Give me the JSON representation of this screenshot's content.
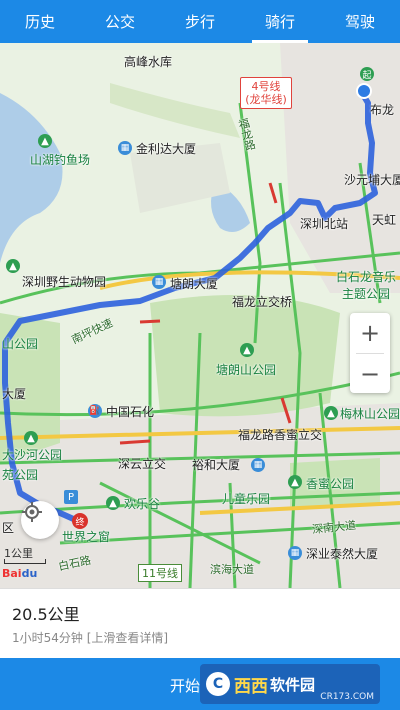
{
  "tabs": [
    {
      "label": "历史"
    },
    {
      "label": "公交"
    },
    {
      "label": "步行"
    },
    {
      "label": "骑行"
    },
    {
      "label": "驾驶"
    }
  ],
  "active_tab": "骑行",
  "map": {
    "labels": {
      "gaofeng": "高峰水库",
      "fulong_top": "布龙",
      "shanhu": "山湖钓鱼场",
      "jinlida": "金利达大厦",
      "fulong_road": "福龙路",
      "shayuan": "沙元埔大厦",
      "shenzhen_north": "深圳北站",
      "tianjian": "天虹",
      "zoo": "深圳野生动物园",
      "tanglang_bld": "塘朗大厦",
      "bailong": "白石龙音乐",
      "theme": "主题公园",
      "nanping": "南坪快速",
      "fulong_bridge": "福龙立交桥",
      "park_left": "山公园",
      "tanglangshan": "塘朗山公园",
      "big_bld": "大厦",
      "sinopec": "中国石化",
      "meilin": "梅林山公园",
      "fulong_xiangmi": "福龙路香蜜立交",
      "dashahe": "大沙河公园",
      "shenyun": "深云立交",
      "yuhe": "裕和大厦",
      "yuan": "苑公园",
      "xiangmi": "香蜜公园",
      "happy_valley": "欢乐谷",
      "children": "儿童乐园",
      "window": "世界之窗",
      "shennan": "深南大道",
      "baishi": "白石路",
      "binhai": "滨海大道",
      "taiping": "深业泰然大厦",
      "left_edge": "区"
    },
    "line4": "4号线(龙华线)",
    "line11": "11号线",
    "start_marker": "起",
    "end_marker": "终",
    "scale_text": "1公里",
    "baidu_logo": "Bai",
    "baidu_logo2": "du"
  },
  "zoom": {
    "plus": "+",
    "minus": "−"
  },
  "route": {
    "distance": "20.5公里",
    "duration": "1小时54分钟  [上滑查看详情]"
  },
  "start_button": "开始导航",
  "watermark": {
    "logo": "C",
    "name": "西西",
    "suffix": "软件园",
    "url": "CR173.COM"
  }
}
